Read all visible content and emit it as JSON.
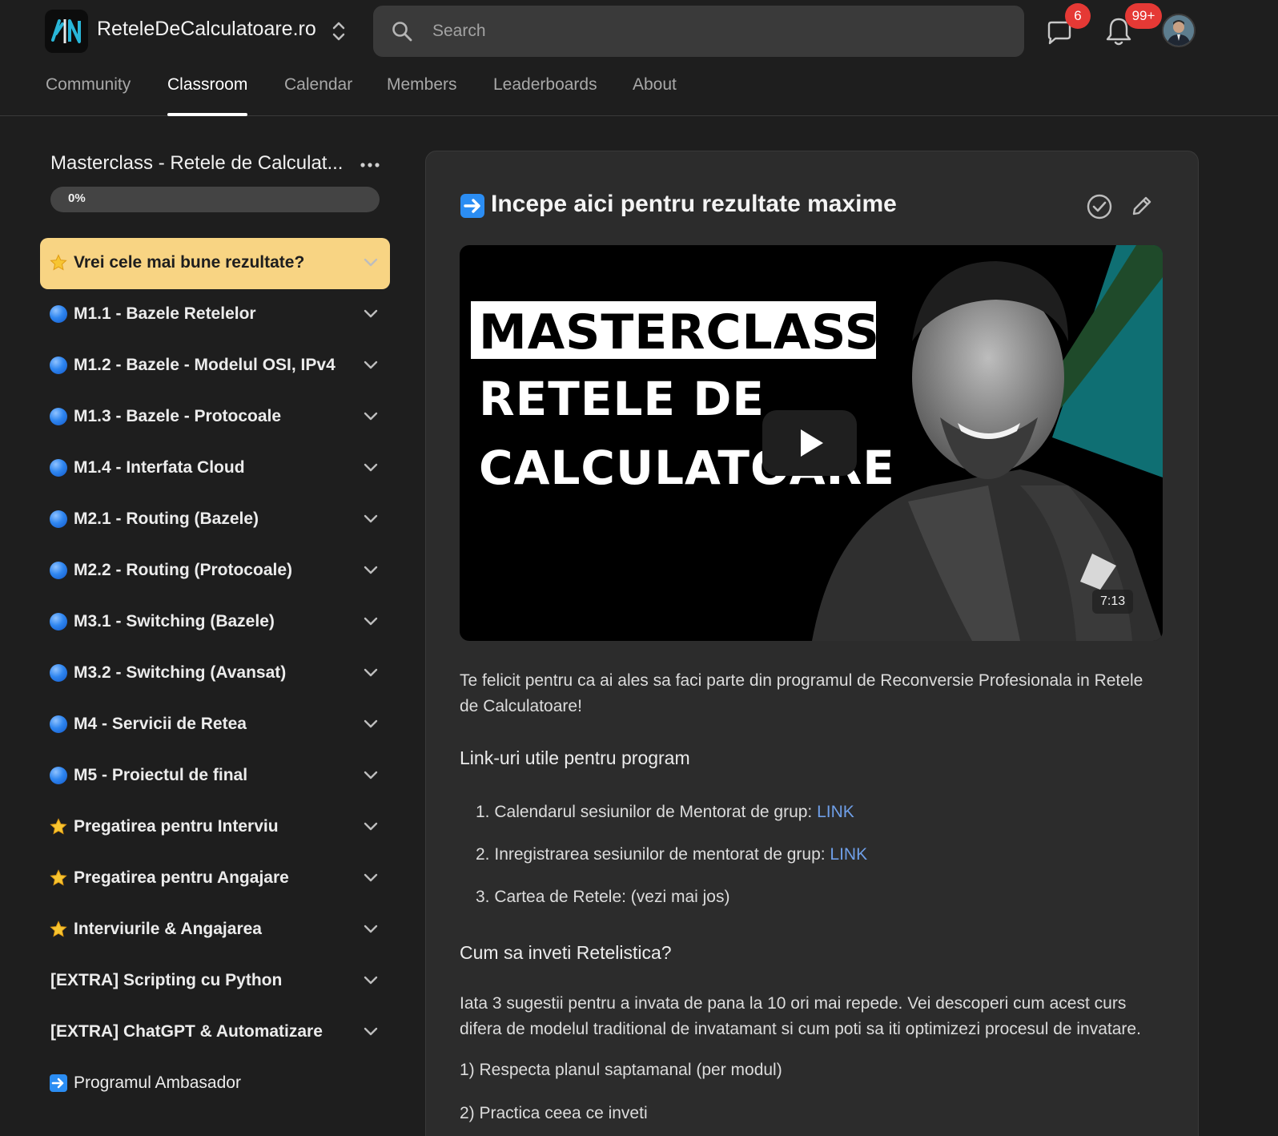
{
  "header": {
    "brand": "ReteleDeCalculatoare.ro",
    "search_placeholder": "Search",
    "chat_badge": "6",
    "notifications_badge": "99+"
  },
  "nav": {
    "tabs": [
      {
        "label": "Community",
        "active": false
      },
      {
        "label": "Classroom",
        "active": true
      },
      {
        "label": "Calendar",
        "active": false
      },
      {
        "label": "Members",
        "active": false
      },
      {
        "label": "Leaderboards",
        "active": false
      },
      {
        "label": "About",
        "active": false
      }
    ]
  },
  "sidebar": {
    "course_title": "Masterclass - Retele de Calculat...",
    "progress_label": "0%",
    "progress": 0,
    "modules": [
      {
        "icon": "star",
        "label": "Vrei cele mai bune rezultate?",
        "highlight": true
      },
      {
        "icon": "blue-circle",
        "label": "M1.1 - Bazele Retelelor"
      },
      {
        "icon": "blue-circle",
        "label": "M1.2 - Bazele - Modelul OSI, IPv4"
      },
      {
        "icon": "blue-circle",
        "label": "M1.3 - Bazele - Protocoale"
      },
      {
        "icon": "blue-circle",
        "label": "M1.4 - Interfata Cloud"
      },
      {
        "icon": "blue-circle",
        "label": "M2.1 - Routing (Bazele)"
      },
      {
        "icon": "blue-circle",
        "label": "M2.2 - Routing (Protocoale)"
      },
      {
        "icon": "blue-circle",
        "label": "M3.1 - Switching (Bazele)"
      },
      {
        "icon": "blue-circle",
        "label": "M3.2 - Switching (Avansat)"
      },
      {
        "icon": "blue-circle",
        "label": "M4 - Servicii de Retea"
      },
      {
        "icon": "blue-circle",
        "label": "M5 - Proiectul de final"
      },
      {
        "icon": "star",
        "label": "Pregatirea pentru Interviu"
      },
      {
        "icon": "star",
        "label": "Pregatirea pentru Angajare"
      },
      {
        "icon": "star",
        "label": "Interviurile & Angajarea"
      },
      {
        "icon": "none",
        "label": "[EXTRA] Scripting cu Python"
      },
      {
        "icon": "none",
        "label": "[EXTRA] ChatGPT & Automatizare"
      },
      {
        "icon": "arrow-right",
        "label": "Programul Ambasador",
        "plain": true
      }
    ]
  },
  "lesson": {
    "title": "Incepe aici pentru rezultate maxime",
    "video": {
      "line1": "MASTERCLASS",
      "line2": "RETELE DE",
      "line3": "CALCULATOARE",
      "duration": "7:13"
    },
    "intro": "Te felicit pentru ca ai ales sa faci parte din programul de Reconversie Profesionala in Retele de Calculatoare!",
    "links_heading": "Link-uri utile pentru program",
    "links": [
      {
        "num": "1.",
        "text": "Calendarul sesiunilor de Mentorat de grup: ",
        "link": "LINK"
      },
      {
        "num": "2.",
        "text": "Inregistrarea sesiunilor de mentorat de grup: ",
        "link": "LINK"
      },
      {
        "num": "3.",
        "text": "Cartea de Retele: (vezi mai jos)",
        "link": ""
      }
    ],
    "learn_heading": "Cum sa inveti Retelistica?",
    "learn_text": "Iata 3 sugestii pentru a invata de pana la 10 ori mai repede. Vei descoperi cum acest curs difera de modelul traditional de invatamant si cum poti sa iti optimizezi procesul de invatare.",
    "tips": [
      "1) Respecta planul saptamanal (per modul)",
      "2) Practica ceea ce inveti"
    ]
  },
  "colors": {
    "highlight": "#f8d483",
    "link": "#6f9fe8",
    "badge": "#e53935",
    "blue_icon": "#2f86f0"
  }
}
